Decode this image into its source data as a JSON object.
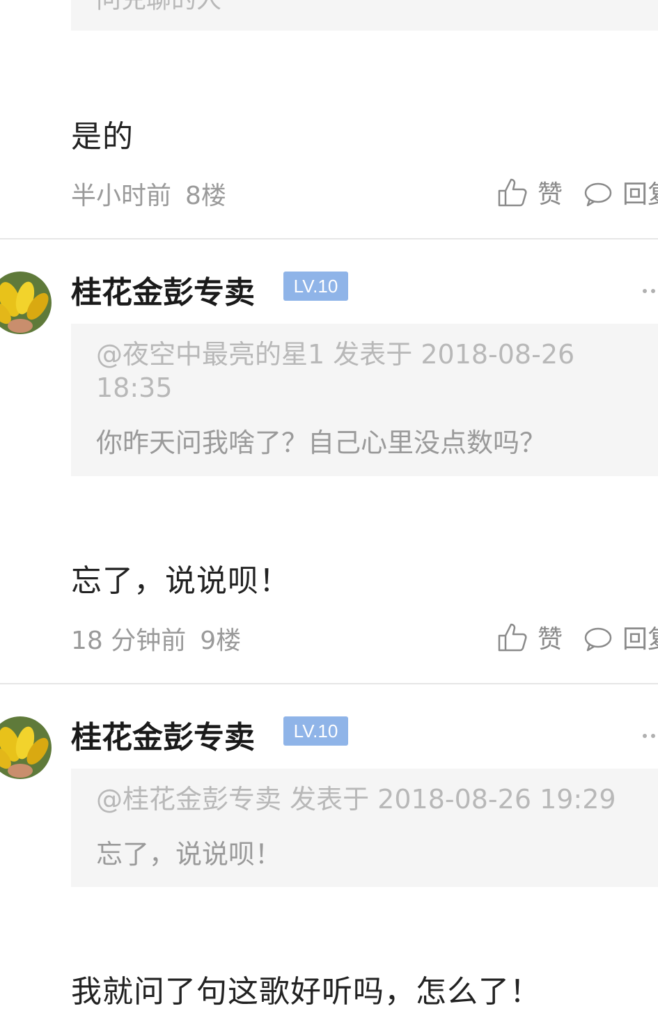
{
  "colors": {
    "level_badge": "#8fb4e8",
    "quote_bg": "#f5f5f5",
    "divider": "#e6e6e6",
    "meta_text": "#9a9a9a"
  },
  "top_quote": {
    "text": "问兑聊的人"
  },
  "comments": [
    {
      "body": "是的",
      "time": "半小时前",
      "floor": "8楼",
      "like_label": "赞",
      "reply_label": "回复"
    },
    {
      "username": "桂花金彭专卖",
      "level": "LV.10",
      "avatar_icon": "avatar-icon",
      "quote_head": "@夜空中最亮的星1 发表于 2018-08-26 18:35",
      "quote_body": "你昨天问我啥了？自己心里没点数吗？",
      "body": "忘了，说说呗！",
      "time": "18 分钟前",
      "floor": "9楼",
      "like_label": "赞",
      "reply_label": "回复"
    },
    {
      "username": "桂花金彭专卖",
      "level": "LV.10",
      "avatar_icon": "avatar-icon",
      "quote_head": "@桂花金彭专卖 发表于 2018-08-26 19:29",
      "quote_body": "忘了，说说呗！",
      "body": "我就问了句这歌好听吗，怎么了！"
    }
  ]
}
